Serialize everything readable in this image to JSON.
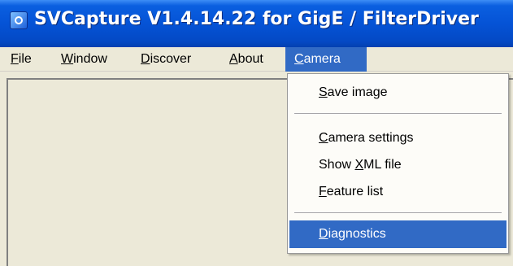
{
  "window": {
    "title": "SVCapture V1.4.14.22 for GigE / FilterDriver"
  },
  "menubar": {
    "items": [
      {
        "label": "File",
        "accel": "F",
        "rest": "ile"
      },
      {
        "label": "Window",
        "accel": "W",
        "rest": "indow"
      },
      {
        "label": "Discover",
        "accel": "D",
        "rest": "iscover"
      },
      {
        "label": "About",
        "accel": "A",
        "rest": "bout"
      },
      {
        "label": "Camera",
        "accel": "C",
        "rest": "amera"
      }
    ],
    "active_index": 4
  },
  "camera_menu": {
    "items": [
      {
        "label": "Save image",
        "accel": "S",
        "rest": "ave image"
      },
      {
        "label": "Camera settings",
        "accel": "C",
        "rest": "amera settings"
      },
      {
        "label": "Show XML file",
        "pre": "Show ",
        "accel": "X",
        "rest": "ML file"
      },
      {
        "label": "Feature list",
        "accel": "F",
        "rest": "eature list"
      },
      {
        "label": "Diagnostics",
        "accel": "D",
        "rest": "iagnostics"
      }
    ],
    "selected_label": "Diagnostics"
  },
  "colors": {
    "titlebar_blue": "#0553d6",
    "highlight": "#316ac5",
    "face": "#ece9d8"
  },
  "icons": {
    "app": "svcapture-app-icon"
  }
}
